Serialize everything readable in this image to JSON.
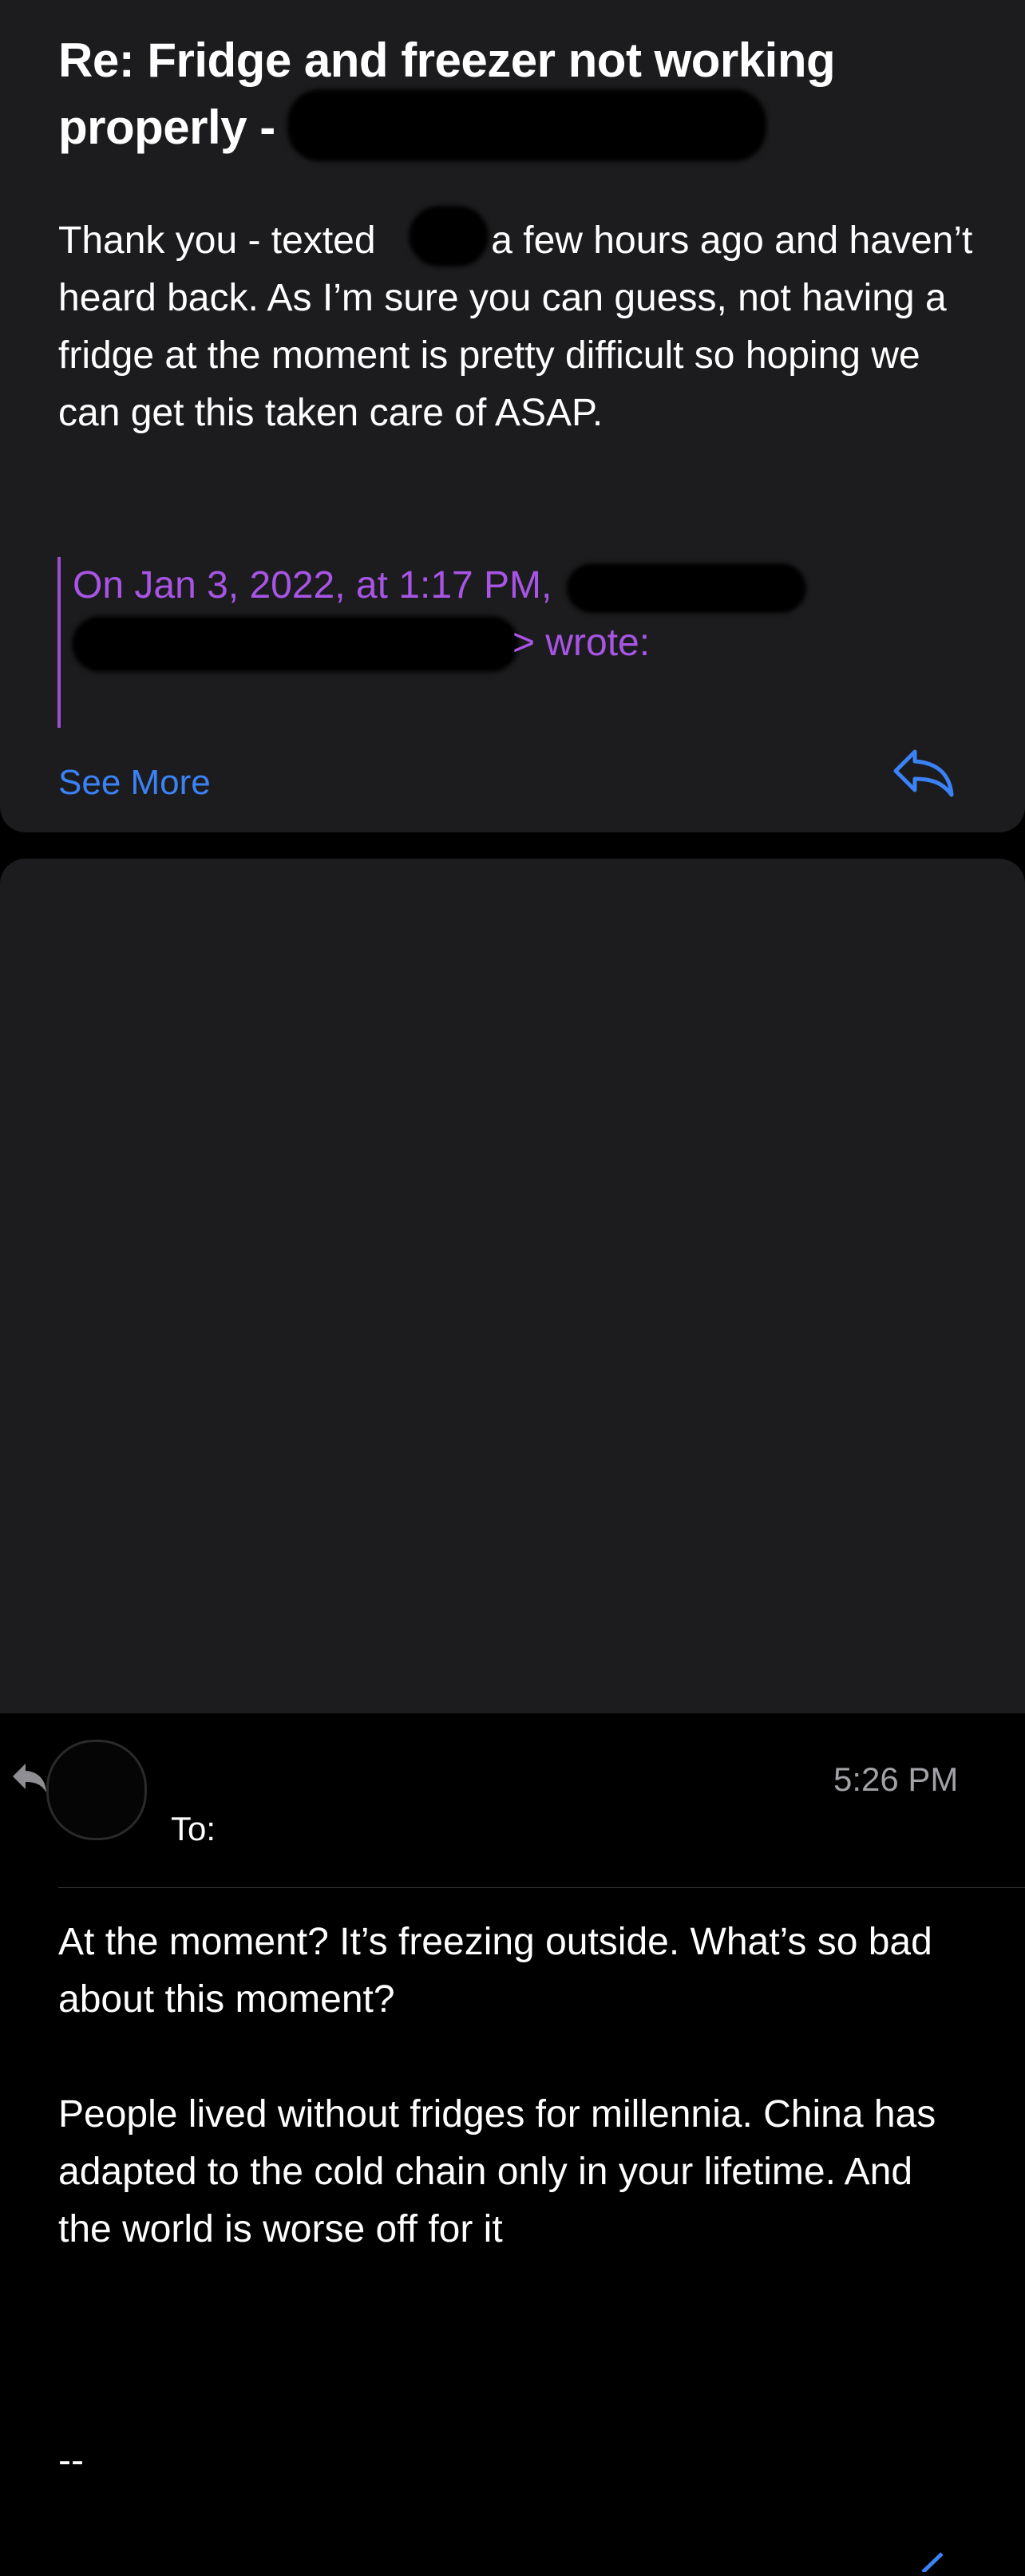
{
  "message1": {
    "subject": "Re: Fridge and freezer not working properly -",
    "body_part1": "Thank you - texted",
    "body_part2": "a few hours ago and haven’t heard back. As I’m sure you can guess, not having a fridge at the moment is pretty difficult so hoping we can get this taken care of ASAP.",
    "quote_header": "On Jan 3, 2022, at 1:17 PM,",
    "quote_wrote": "> wrote:",
    "see_more_label": "See More",
    "reply_icon": "reply-icon"
  },
  "message2": {
    "time": "5:26 PM",
    "to_label": "To:",
    "paragraph1": "At the moment?  It’s freezing outside. What’s so bad about this moment?",
    "paragraph2": "People lived without fridges for millennia. China has adapted to the cold chain only in your lifetime. And the world is worse off for it",
    "signature_separator": "--"
  },
  "colors": {
    "card_background": "#1c1c1e",
    "page_background": "#000000",
    "link_blue": "#3b82f6",
    "quote_purple": "#a855e6",
    "secondary_gray": "#a1a1a6"
  }
}
